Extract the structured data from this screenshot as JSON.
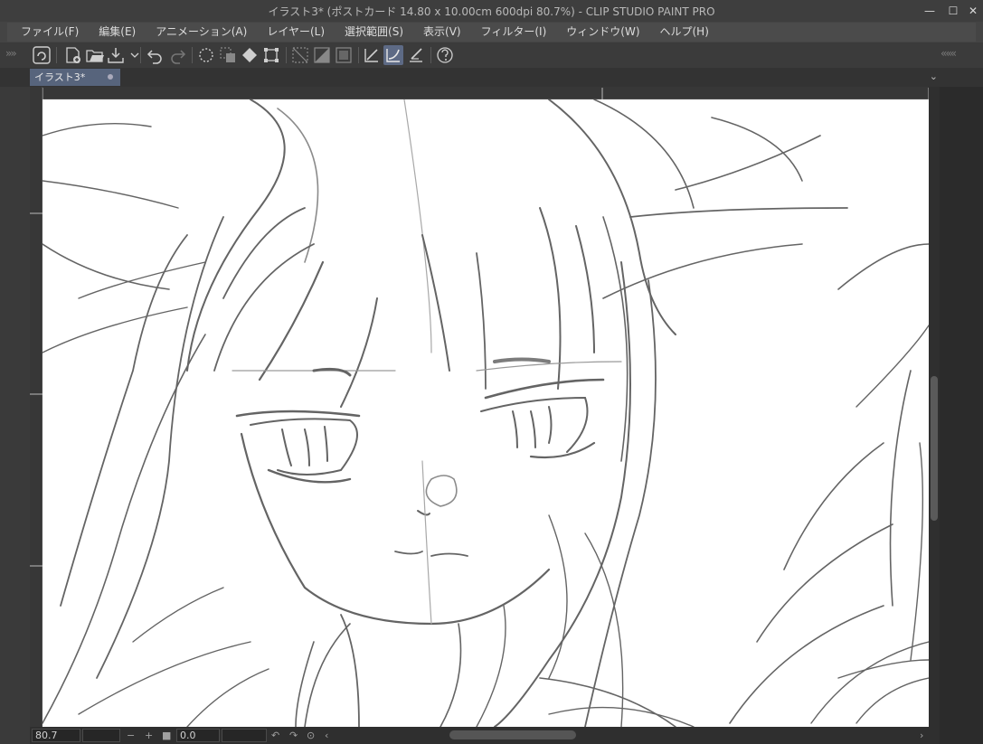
{
  "window": {
    "title": "イラスト3* (ポストカード 14.80 x 10.00cm 600dpi 80.7%)  - CLIP STUDIO PAINT PRO",
    "controls": {
      "minimize": "—",
      "maximize": "☐",
      "close": "✕"
    }
  },
  "menu": {
    "items": [
      {
        "label": "ファイル(F)"
      },
      {
        "label": "編集(E)"
      },
      {
        "label": "アニメーション(A)"
      },
      {
        "label": "レイヤー(L)"
      },
      {
        "label": "選択範囲(S)"
      },
      {
        "label": "表示(V)"
      },
      {
        "label": "フィルター(I)"
      },
      {
        "label": "ウィンドウ(W)"
      },
      {
        "label": "ヘルプ(H)"
      }
    ]
  },
  "toolbar": {
    "left_arrows": "»»",
    "right_arrows": "«««",
    "icons": [
      "clip-studio-icon",
      "new-canvas-icon",
      "open-file-icon",
      "save-icon",
      "undo-icon",
      "redo-icon",
      "deselect-icon",
      "clear-icon",
      "fill-icon",
      "transform-icon",
      "hide-selection-icon",
      "invert-selection-icon",
      "border-icon",
      "vector-erase-icon",
      "snap-ruler-icon",
      "snap-special-ruler-icon",
      "help-icon"
    ]
  },
  "tabs": [
    {
      "label": "イラスト3*",
      "active": true
    }
  ],
  "tab_menu_icon": "⌄",
  "status": {
    "zoom": "80.7",
    "rotation": "0.0"
  },
  "colors": {
    "accent": "#5d6a85",
    "tab_active": "#57647c",
    "canvas": "#ffffff"
  }
}
